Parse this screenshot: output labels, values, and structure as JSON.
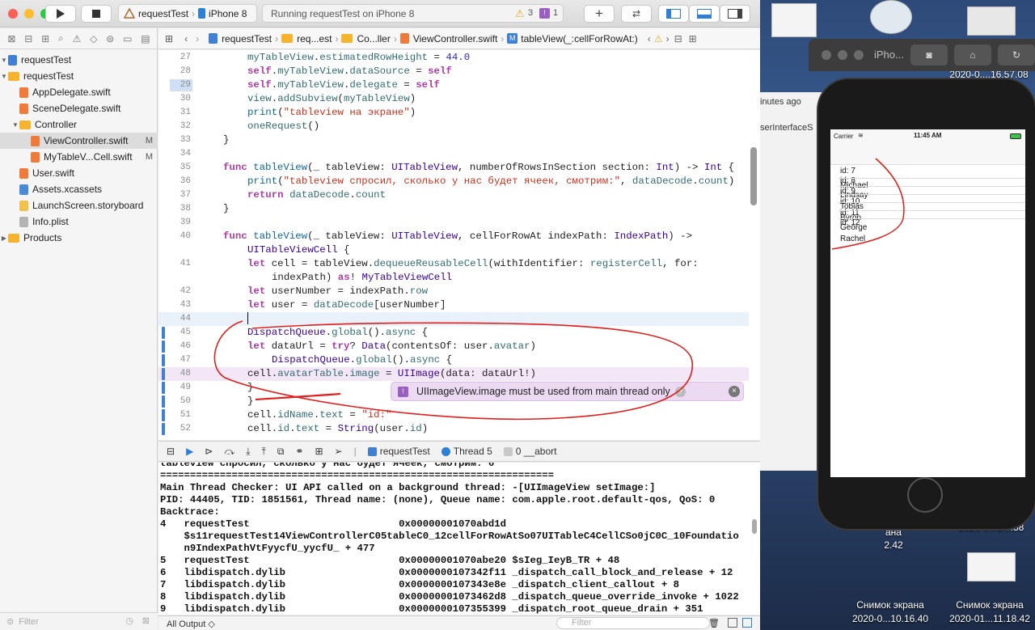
{
  "toolbar": {
    "scheme": "requestTest",
    "device": "iPhone 8",
    "activity": "Running requestTest on iPhone 8",
    "warnings": "3",
    "issues": "1"
  },
  "navigator": {
    "items": [
      {
        "label": "requestTest",
        "icon": "project-icon",
        "depth": 0,
        "expanded": true,
        "flag": ""
      },
      {
        "label": "requestTest",
        "icon": "folder-icon",
        "depth": 0,
        "expanded": true,
        "flag": ""
      },
      {
        "label": "AppDelegate.swift",
        "icon": "swift-file-icon",
        "depth": 1,
        "flag": ""
      },
      {
        "label": "SceneDelegate.swift",
        "icon": "swift-file-icon",
        "depth": 1,
        "flag": ""
      },
      {
        "label": "Controller",
        "icon": "folder-icon",
        "depth": 1,
        "expanded": true,
        "flag": ""
      },
      {
        "label": "ViewController.swift",
        "icon": "swift-file-icon",
        "depth": 2,
        "flag": "M",
        "selected": true
      },
      {
        "label": "MyTableV...Cell.swift",
        "icon": "swift-file-icon",
        "depth": 2,
        "flag": "M"
      },
      {
        "label": "User.swift",
        "icon": "swift-file-icon",
        "depth": 1,
        "flag": ""
      },
      {
        "label": "Assets.xcassets",
        "icon": "assets-icon",
        "depth": 1,
        "flag": ""
      },
      {
        "label": "LaunchScreen.storyboard",
        "icon": "storyboard-icon",
        "depth": 1,
        "flag": ""
      },
      {
        "label": "Info.plist",
        "icon": "plist-icon",
        "depth": 1,
        "flag": ""
      },
      {
        "label": "Products",
        "icon": "folder-icon",
        "depth": 0,
        "expanded": false,
        "flag": ""
      }
    ],
    "filter_placeholder": "Filter"
  },
  "jumpbar": {
    "crumbs": [
      "requestTest",
      "req...est",
      "Co...ller",
      "ViewController.swift",
      "tableView(_:cellForRowAt:)"
    ]
  },
  "editor": {
    "lines": [
      {
        "n": "27",
        "html": "<span class='pr'>myTableView</span>.<span class='pr'>estimatedRowHeight</span> = <span class='nm'>44.0</span>",
        "indent": 2
      },
      {
        "n": "28",
        "html": "<span class='kw'>self</span>.<span class='pr'>myTableView</span>.<span class='pr'>dataSource</span> = <span class='kw'>self</span>",
        "indent": 2
      },
      {
        "n": "29",
        "html": "<span class='kw'>self</span>.<span class='pr'>myTableView</span>.<span class='pr'>delegate</span> = <span class='kw'>self</span>",
        "indent": 2
      },
      {
        "n": "30",
        "html": "<span class='pr'>view</span>.<span class='pr'>addSubview</span>(<span class='pr'>myTableView</span>)",
        "indent": 2
      },
      {
        "n": "31",
        "html": "<span class='fn'>print</span>(<span class='st'>\"tableview на экране\"</span>)",
        "indent": 2
      },
      {
        "n": "32",
        "html": "<span class='pr'>oneRequest</span>()",
        "indent": 2
      },
      {
        "n": "33",
        "html": "}",
        "indent": 1
      },
      {
        "n": "34",
        "html": "",
        "indent": 0
      },
      {
        "n": "35",
        "html": "<span class='kw'>func</span> <span class='fn'>tableView</span>(_ tableView: <span class='ty'>UITableView</span>, numberOfRowsInSection section: <span class='ty'>Int</span>) -> <span class='ty'>Int</span> {",
        "indent": 1
      },
      {
        "n": "36",
        "html": "<span class='fn'>print</span>(<span class='st'>\"tableview спросил, сколько у нас будет ячеек, смотрим:\"</span>, <span class='pr'>dataDecode</span>.<span class='pr'>count</span>)",
        "indent": 2
      },
      {
        "n": "37",
        "html": "<span class='kw'>return</span> <span class='pr'>dataDecode</span>.<span class='pr'>count</span>",
        "indent": 2
      },
      {
        "n": "38",
        "html": "}",
        "indent": 1
      },
      {
        "n": "39",
        "html": "",
        "indent": 0
      },
      {
        "n": "40",
        "html": "<span class='kw'>func</span> <span class='fn'>tableView</span>(_ tableView: <span class='ty'>UITableView</span>, cellForRowAt indexPath: <span class='ty'>IndexPath</span>) ->",
        "indent": 1
      },
      {
        "n": "",
        "html": "<span class='ty'>UITableViewCell</span> {",
        "indent": 2
      },
      {
        "n": "41",
        "html": "<span class='kw'>let</span> cell = tableView.<span class='pr'>dequeueReusableCell</span>(withIdentifier: <span class='pr'>registerCell</span>, for:",
        "indent": 2
      },
      {
        "n": "",
        "html": "indexPath) <span class='kw'>as</span>! <span class='ty'>MyTableViewCell</span>",
        "indent": 3
      },
      {
        "n": "42",
        "html": "<span class='kw'>let</span> userNumber = indexPath.<span class='pr'>row</span>",
        "indent": 2
      },
      {
        "n": "43",
        "html": "<span class='kw'>let</span> user = <span class='pr'>dataDecode</span>[userNumber]",
        "indent": 2
      },
      {
        "n": "44",
        "html": "",
        "indent": 2
      },
      {
        "n": "45",
        "html": "<span class='ty'>DispatchQueue</span>.<span class='pr'>global</span>().<span class='pr'>async</span> {",
        "indent": 2
      },
      {
        "n": "46",
        "html": "<span class='kw'>let</span> dataUrl = <span class='kw'>try</span>? <span class='ty'>Data</span>(contentsOf: user.<span class='pr'>avatar</span>)",
        "indent": 2
      },
      {
        "n": "47",
        "html": "<span class='ty'>DispatchQueue</span>.<span class='pr'>global</span>().<span class='pr'>async</span> {",
        "indent": 3
      },
      {
        "n": "48",
        "html": "cell.<span class='pr'>avatarTable</span>.<span class='pr'>image</span> = <span class='ty'>UIImage</span>(data: dataUrl!)",
        "indent": 2
      },
      {
        "n": "49",
        "html": "}",
        "indent": 2
      },
      {
        "n": "50",
        "html": "}",
        "indent": 2
      },
      {
        "n": "51",
        "html": "cell.<span class='pr'>idName</span>.<span class='pr'>text</span> = <span class='st'>\"id:\"</span>",
        "indent": 2
      },
      {
        "n": "52",
        "html": "cell.<span class='pr'>id</span>.<span class='pr'>text</span> = <span class='ty'>String</span>(user.<span class='pr'>id</span>)",
        "indent": 2
      }
    ],
    "issue_message": "UIImageView.image must be used from main thread only"
  },
  "debugbar": {
    "app": "requestTest",
    "thread": "Thread 5",
    "frame": "0 __abort"
  },
  "console": {
    "lines": [
      "tableview спросил, сколько у нас будет ячеек, смотрим: 6",
      "==================================================================",
      "Main Thread Checker: UI API called on a background thread: -[UIImageView setImage:]",
      "PID: 44405, TID: 1851561, Thread name: (none), Queue name: com.apple.root.default-qos, QoS: 0",
      "Backtrace:",
      "4   requestTest                         0x00000001070abd1d",
      "    $s11requestTest14ViewControllerC05tableC0_12cellForRowAtSo07UITableC4CellCSo0jC0C_10Foundatio",
      "    n9IndexPathVtFyycfU_yycfU_ + 477",
      "5   requestTest                         0x00000001070abe20 $sIeg_IeyB_TR + 48",
      "6   libdispatch.dylib                   0x0000000107342f11 _dispatch_call_block_and_release + 12",
      "7   libdispatch.dylib                   0x0000000107343e8e _dispatch_client_callout + 8",
      "8   libdispatch.dylib                   0x00000001073462d8 _dispatch_queue_override_invoke + 1022",
      "9   libdispatch.dylib                   0x0000000107355399 _dispatch_root_queue_drain + 351"
    ],
    "output_selector": "All Output ◇",
    "filter_placeholder": "Filter"
  },
  "desktop": {
    "time_partial": "2020-0....16.57.08",
    "minutes_ago": "inutes ago",
    "interface_partial": "serInterfaceS",
    "simulator_title": "iPho...",
    "screenshot1_title": "Снимок экрана",
    "screenshot1_date": "2020-0...10.16.40",
    "screenshot2_title": "Снимок экрана",
    "screenshot2_date": "2020-01...11.18.42",
    "partial_label_1": "ана",
    "partial_label_2": "2.42",
    "partial_label_3": "2020-0...1.5.58"
  },
  "simulator": {
    "carrier": "Carrier",
    "time": "11:45 AM",
    "rows": [
      {
        "text": "id:  7"
      },
      {
        "text": "id:  8"
      },
      {
        "text": "Michael"
      },
      {
        "text": "Lindsay"
      },
      {
        "text": "id:  9"
      },
      {
        "text": "Tobias"
      },
      {
        "text": "id:  10"
      },
      {
        "text": "Byron"
      },
      {
        "text": "id:  11"
      },
      {
        "text": "id:  12"
      },
      {
        "text": "George"
      },
      {
        "text": "Rachel"
      }
    ]
  },
  "colors": {
    "accent": "#3f7fd6",
    "annotation_red": "#e0201c",
    "issue_bubble": "#ecd9f2"
  }
}
